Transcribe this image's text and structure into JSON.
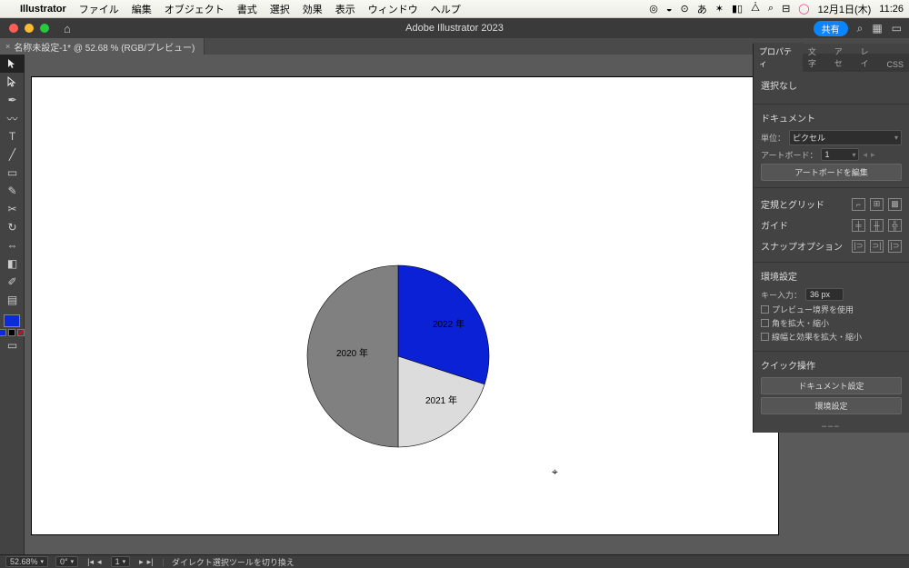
{
  "mac_menu": {
    "app_name": "Illustrator",
    "items": [
      "ファイル",
      "編集",
      "オブジェクト",
      "書式",
      "選択",
      "効果",
      "表示",
      "ウィンドウ",
      "ヘルプ"
    ],
    "date": "12月1日(木)",
    "time": "11:26"
  },
  "app_bar": {
    "title": "Adobe Illustrator 2023",
    "share": "共有",
    "doc_tab": "名称未設定-1* @ 52.68 % (RGB/プレビュー)"
  },
  "chart_data": {
    "type": "pie",
    "title": "",
    "series": [
      {
        "name": "2022 年",
        "value": 30,
        "color": "#0b21d6"
      },
      {
        "name": "2021 年",
        "value": 20,
        "color": "#dcdcdc"
      },
      {
        "name": "2020 年",
        "value": 50,
        "color": "#808080"
      }
    ]
  },
  "panel": {
    "tabs": [
      "プロパティ",
      "文字",
      "アセ",
      "レイ",
      "CSS"
    ],
    "no_selection": "選択なし",
    "document_hdr": "ドキュメント",
    "units_label": "単位：",
    "units_value": "ピクセル",
    "artboard_label": "アートボード：",
    "artboard_value": "1",
    "edit_artboard_btn": "アートボードを編集",
    "ruler_hdr": "定規とグリッド",
    "guide_hdr": "ガイド",
    "snap_hdr": "スナップオプション",
    "env_hdr": "環境設定",
    "key_label": "キー入力：",
    "key_value": "36 px",
    "chk1": "プレビュー境界を使用",
    "chk2": "角を拡大・縮小",
    "chk3": "線幅と効果を拡大・縮小",
    "quick_hdr": "クイック操作",
    "doc_settings_btn": "ドキュメント設定",
    "env_settings_btn": "環境設定"
  },
  "status": {
    "zoom": "52.68%",
    "angle": "0°",
    "tool_hint": "ダイレクト選択ツールを切り換え"
  }
}
